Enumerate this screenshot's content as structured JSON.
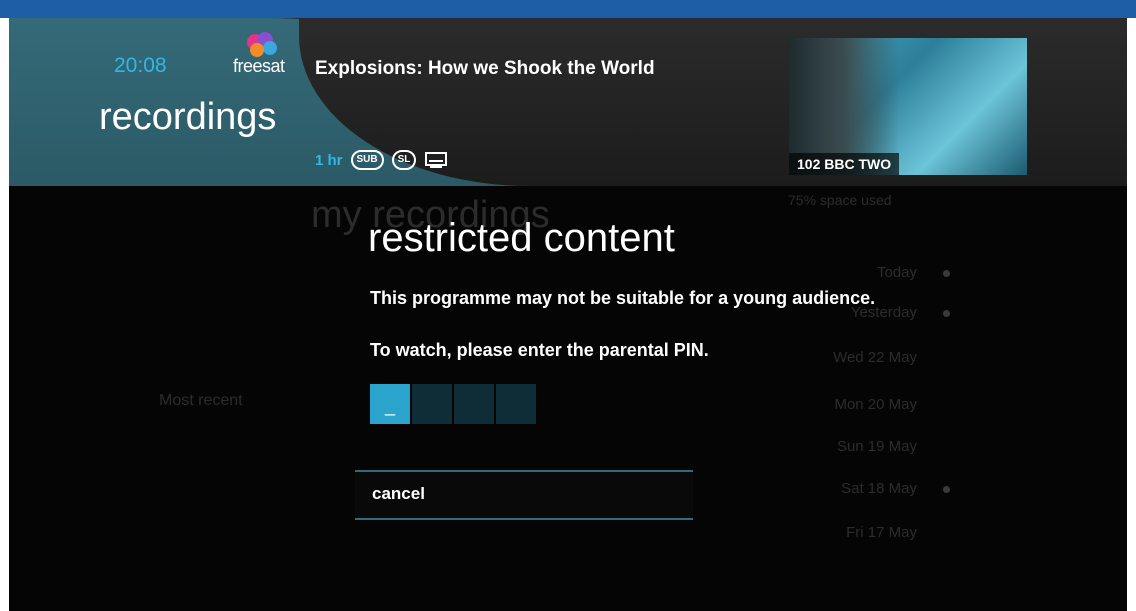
{
  "header": {
    "time": "20:08",
    "brand": "freesat",
    "section": "recordings",
    "programme_title": "Explosions: How we Shook the World",
    "duration": "1 hr",
    "badges": [
      "SUB",
      "SL"
    ],
    "subtitle_icon": "subtitles-screen-icon",
    "channel": "102 BBC TWO"
  },
  "background_list": {
    "heading": "my recordings",
    "space_used": "75% space used",
    "side_label": "Most recent",
    "rows": [
      {
        "title": "",
        "date": "Today",
        "has_dot": true
      },
      {
        "title": "",
        "date": "Yesterday",
        "has_dot": true
      },
      {
        "title": "",
        "date": "Wed 22 May",
        "has_dot": false
      },
      {
        "title": "",
        "date": "Mon 20 May",
        "has_dot": false
      },
      {
        "title": "",
        "date": "Sun 19 May",
        "has_dot": false
      },
      {
        "title": "",
        "date": "Sat 18 May",
        "has_dot": true
      },
      {
        "title": "",
        "date": "Fri 17 May",
        "has_dot": false
      }
    ]
  },
  "dialog": {
    "title": "restricted content",
    "message": "This programme may not be suitable for a young audience.",
    "instruction": "To watch, please enter the parental PIN.",
    "pin_digits": [
      "_",
      "",
      "",
      ""
    ],
    "cancel_label": "cancel"
  },
  "colors": {
    "accent": "#32b6e6",
    "header_teal": "#2b5a66",
    "top_bar": "#1d5ea6",
    "pin_active": "#2aa4cc"
  }
}
